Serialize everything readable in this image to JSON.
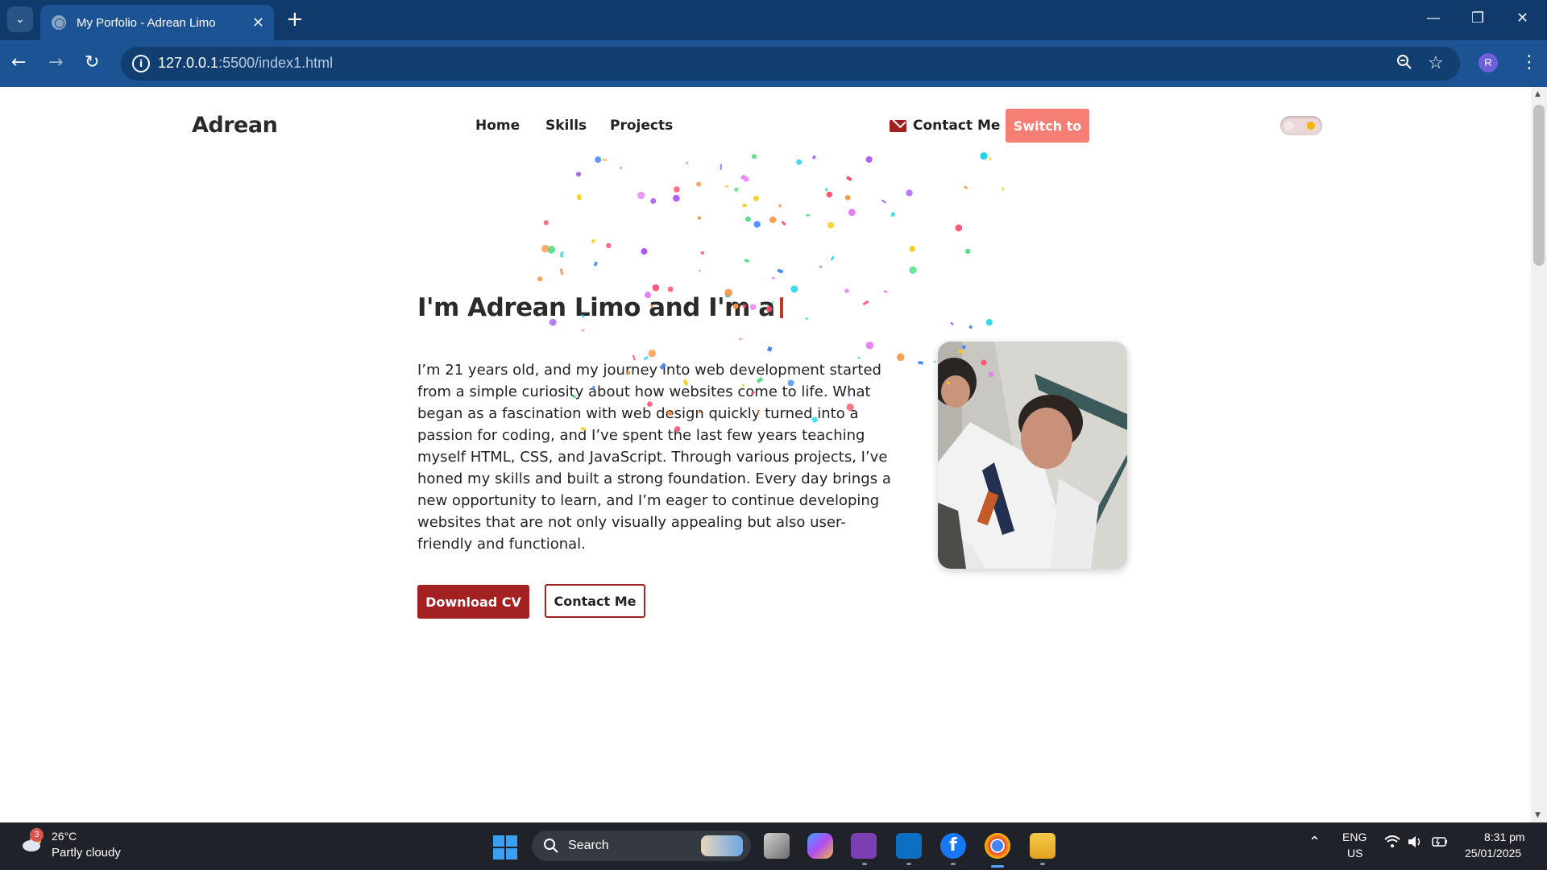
{
  "browser": {
    "tab_title": "My Porfolio - Adrean Limo",
    "url_host": "127.0.0.1",
    "url_path": ":5500/index1.html",
    "profile_initial": "R"
  },
  "site": {
    "brand": "Adrean",
    "nav": [
      "Home",
      "Skills",
      "Projects"
    ],
    "contact_link": "Contact Me",
    "switch_button": "Switch to",
    "hero_title": "I'm Adrean Limo and I'm a",
    "hero_paragraph": "I’m 21 years old, and my journey into web development started from a simple curiosity about how websites come to life. What began as a fascination with web design quickly turned into a passion for coding, and I’ve spent the last few years teaching myself HTML, CSS, and JavaScript. Through various projects, I’ve honed my skills and built a strong foundation. Every day brings a new opportunity to learn, and I’m eager to continue developing websites that are not only visually appealing but also user-friendly and functional.",
    "download_button": "Download CV",
    "contact_button": "Contact Me"
  },
  "taskbar": {
    "weather_badge": "3",
    "temperature": "26°C",
    "weather": "Partly cloudy",
    "search_label": "Search",
    "lang_top": "ENG",
    "lang_bottom": "US",
    "time": "8:31 pm",
    "date": "25/01/2025"
  },
  "colors": {
    "chrome": "#1c5394",
    "accent": "#a32121",
    "switch": "#f57f74"
  }
}
